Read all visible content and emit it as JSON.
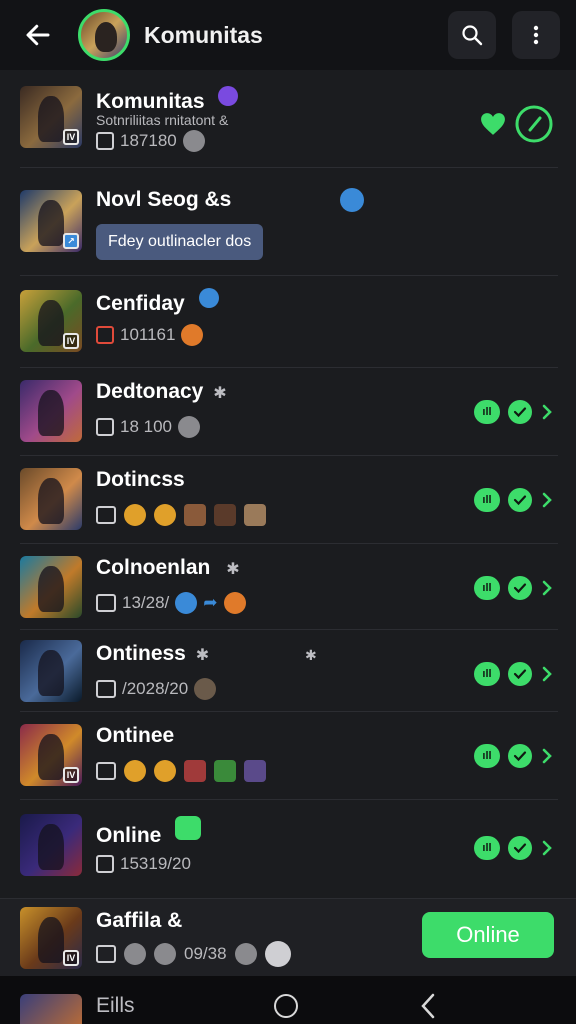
{
  "header": {
    "title": "Komunitas"
  },
  "rows": [
    {
      "name": "Komunitas",
      "sub_text": "Sotnriliitas rnitatont &",
      "count": "187180",
      "tag": "IV",
      "bg": [
        "#3a2a22",
        "#8b6a3e",
        "#2b3a66"
      ]
    },
    {
      "name": "Novl Seog &s",
      "chip": "Fdey outlinacler dos",
      "tag": "↗",
      "bg": [
        "#1e3a6a",
        "#c9a25a",
        "#3b2a6a"
      ]
    },
    {
      "name": "Cenfiday",
      "count": "101161",
      "tag": "IV",
      "bg": [
        "#c8a03a",
        "#4a6a2a",
        "#7a4a22"
      ]
    },
    {
      "name": "Dedtonacy",
      "count": "18 100",
      "bg": [
        "#3a2a6a",
        "#a04a8a",
        "#c06a3a"
      ]
    },
    {
      "name": "Dotincss",
      "bg": [
        "#6a4a2a",
        "#d08a4a",
        "#2a3a6a"
      ]
    },
    {
      "name": "Colnoenlan",
      "count": "13/28/",
      "bg": [
        "#1a7aa0",
        "#c07a2a",
        "#2a4a2a"
      ]
    },
    {
      "name": "Ontiness",
      "count": "/2028/20",
      "bg": [
        "#1a2a4a",
        "#4a6a9a",
        "#0a1a2a"
      ]
    },
    {
      "name": "Ontinee",
      "tag": "IV",
      "bg": [
        "#8a2a4a",
        "#d08a2a",
        "#4a1a5a"
      ]
    },
    {
      "name": "Online",
      "count": "15319/20",
      "bg": [
        "#1a1a4a",
        "#3a2a7a",
        "#8a2a3a"
      ]
    }
  ],
  "footer_row": {
    "name": "Gaffila &",
    "count": "09/38",
    "button_label": "Online"
  },
  "nav": {
    "partial_label": "Eills"
  },
  "colors": {
    "accent": "#3ddc6a",
    "background": "#1b1c1f",
    "topbar": "#121316",
    "badge_blue": "#3a8ad8",
    "badge_purple": "#7a4ae0"
  },
  "icons": {
    "back": "arrow-left-icon",
    "search": "search-icon",
    "menu": "more-vertical-icon",
    "home": "home-circle-icon",
    "nav_back": "chevron-left-icon"
  }
}
